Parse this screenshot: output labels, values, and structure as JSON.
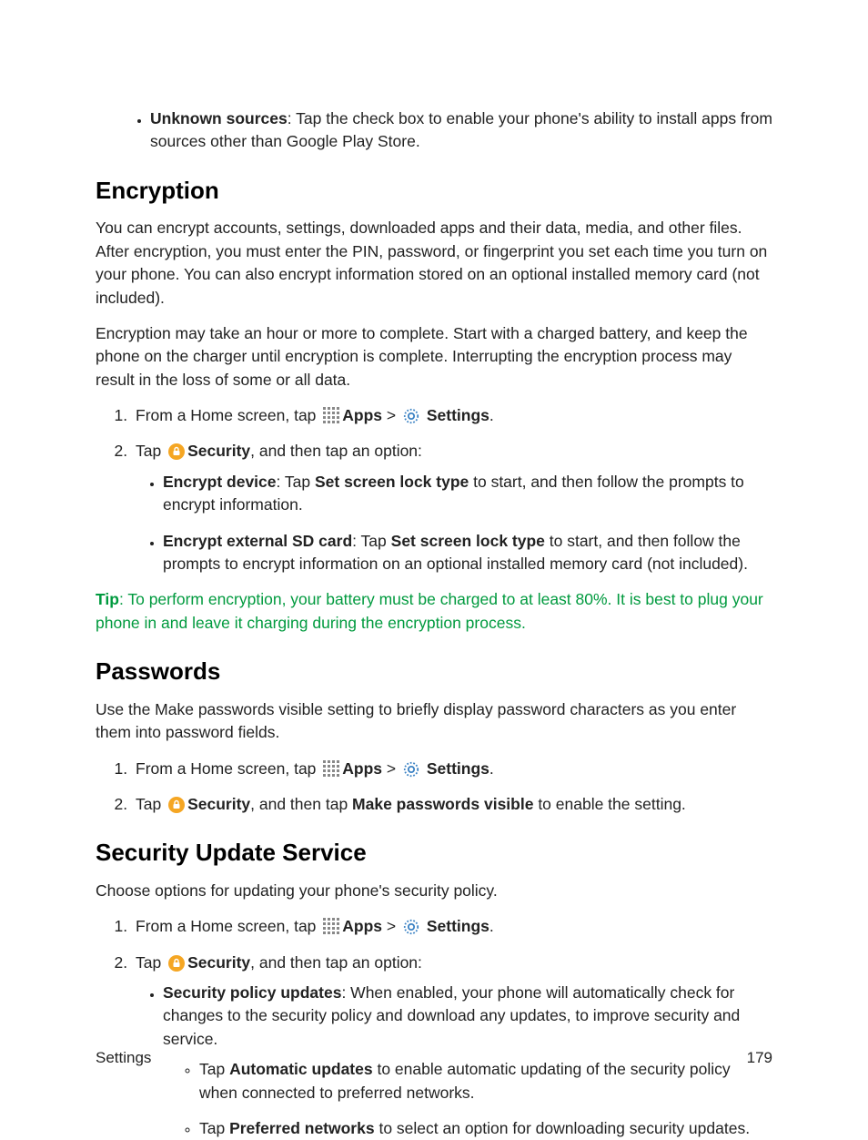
{
  "topBullet": {
    "bold": "Unknown sources",
    "text": ": Tap the check box to enable your phone's ability to install apps from sources other than Google Play Store."
  },
  "sections": {
    "encryption": {
      "heading": "Encryption",
      "p1": "You can encrypt accounts, settings, downloaded apps and their data, media, and other files. After encryption, you must enter the PIN, password, or fingerprint you set each time you turn on your phone. You can also encrypt information stored on an optional installed memory card (not included).",
      "p2": "Encryption may take an hour or more to complete. Start with a charged battery, and keep the phone on the charger until encryption is complete. Interrupting the encryption process may result in the loss of some or all data.",
      "ol1": "From a Home screen, tap ",
      "apps": "Apps",
      "gt": " > ",
      "settings": " Settings",
      "dot": ".",
      "ol2a": "Tap ",
      "security": "Security",
      "ol2b": ", and then tap an option:",
      "sub1bold": "Encrypt device",
      "sub1": ": Tap ",
      "sub1bold2": "Set screen lock type",
      "sub1rest": " to start, and then follow the prompts to encrypt information.",
      "sub2bold": "Encrypt external SD card",
      "sub2": ": Tap ",
      "sub2bold2": "Set screen lock type",
      "sub2rest": " to start, and then follow the prompts to encrypt information on an optional installed memory card (not included).",
      "tipBold": "Tip",
      "tip": ": To perform encryption, your battery must be charged to at least 80%. It is best to plug your phone in and leave it charging during the encryption process."
    },
    "passwords": {
      "heading": "Passwords",
      "p1": "Use the Make passwords visible setting to briefly display password characters as you enter them into password fields.",
      "ol2c": ", and then tap ",
      "mpv": "Make passwords visible",
      "ol2d": " to enable the setting."
    },
    "sus": {
      "heading": "Security Update Service",
      "p1": "Choose options for updating your phone's security policy.",
      "sub1bold": "Security policy updates",
      "sub1": ": When enabled, your phone will automatically check for changes to the security policy and download any updates, to improve security and service.",
      "circ1a": "Tap ",
      "circ1bold": "Automatic updates",
      "circ1b": " to enable automatic updating of the security policy when connected to preferred networks.",
      "circ2a": "Tap ",
      "circ2bold": "Preferred networks",
      "circ2b": " to select an option for downloading security updates."
    }
  },
  "footer": {
    "left": "Settings",
    "right": "179"
  }
}
